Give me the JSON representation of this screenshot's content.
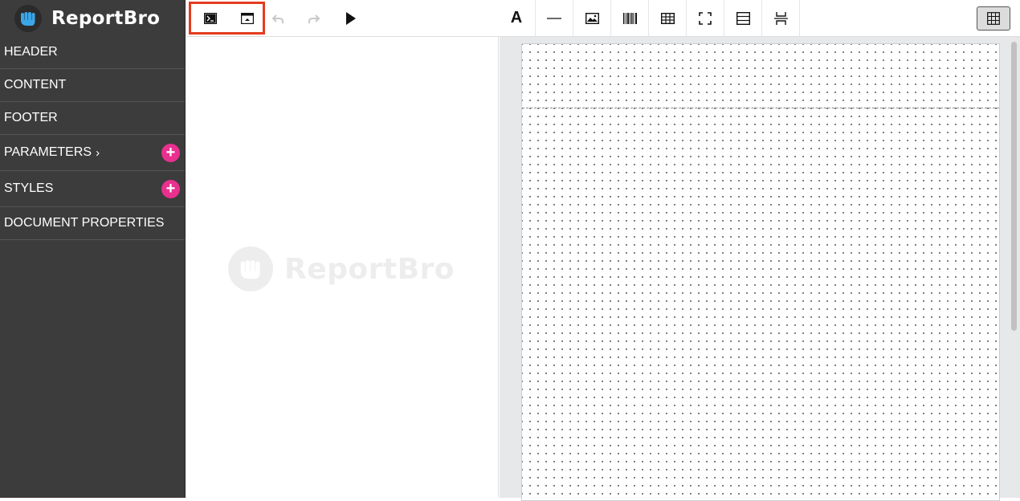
{
  "app": {
    "brand": "ReportBro"
  },
  "sidebar": {
    "items": [
      {
        "label": "HEADER",
        "has_add": false,
        "has_chevron": false
      },
      {
        "label": "CONTENT",
        "has_add": false,
        "has_chevron": false
      },
      {
        "label": "FOOTER",
        "has_add": false,
        "has_chevron": false
      },
      {
        "label": "PARAMETERS",
        "has_add": true,
        "has_chevron": true
      },
      {
        "label": "STYLES",
        "has_add": true,
        "has_chevron": false
      },
      {
        "label": "DOCUMENT PROPERTIES",
        "has_add": false,
        "has_chevron": false
      }
    ],
    "add_glyph": "+",
    "chevron_glyph": "›"
  },
  "toolbar": {
    "text_element_label": "A",
    "buttons": [
      "report-data-icon",
      "page-layout-icon",
      "undo-icon",
      "redo-icon",
      "preview-play-icon",
      "text-icon",
      "line-icon",
      "image-icon",
      "barcode-icon",
      "table-icon",
      "frame-icon",
      "section-icon",
      "page-break-icon",
      "grid-toggle-icon"
    ]
  },
  "watermark": {
    "text": "ReportBro"
  },
  "colors": {
    "sidebar_bg": "#3c3c3c",
    "accent": "#e8308e",
    "highlight": "#e53b1f",
    "canvas_bg": "#e6e8ea"
  }
}
